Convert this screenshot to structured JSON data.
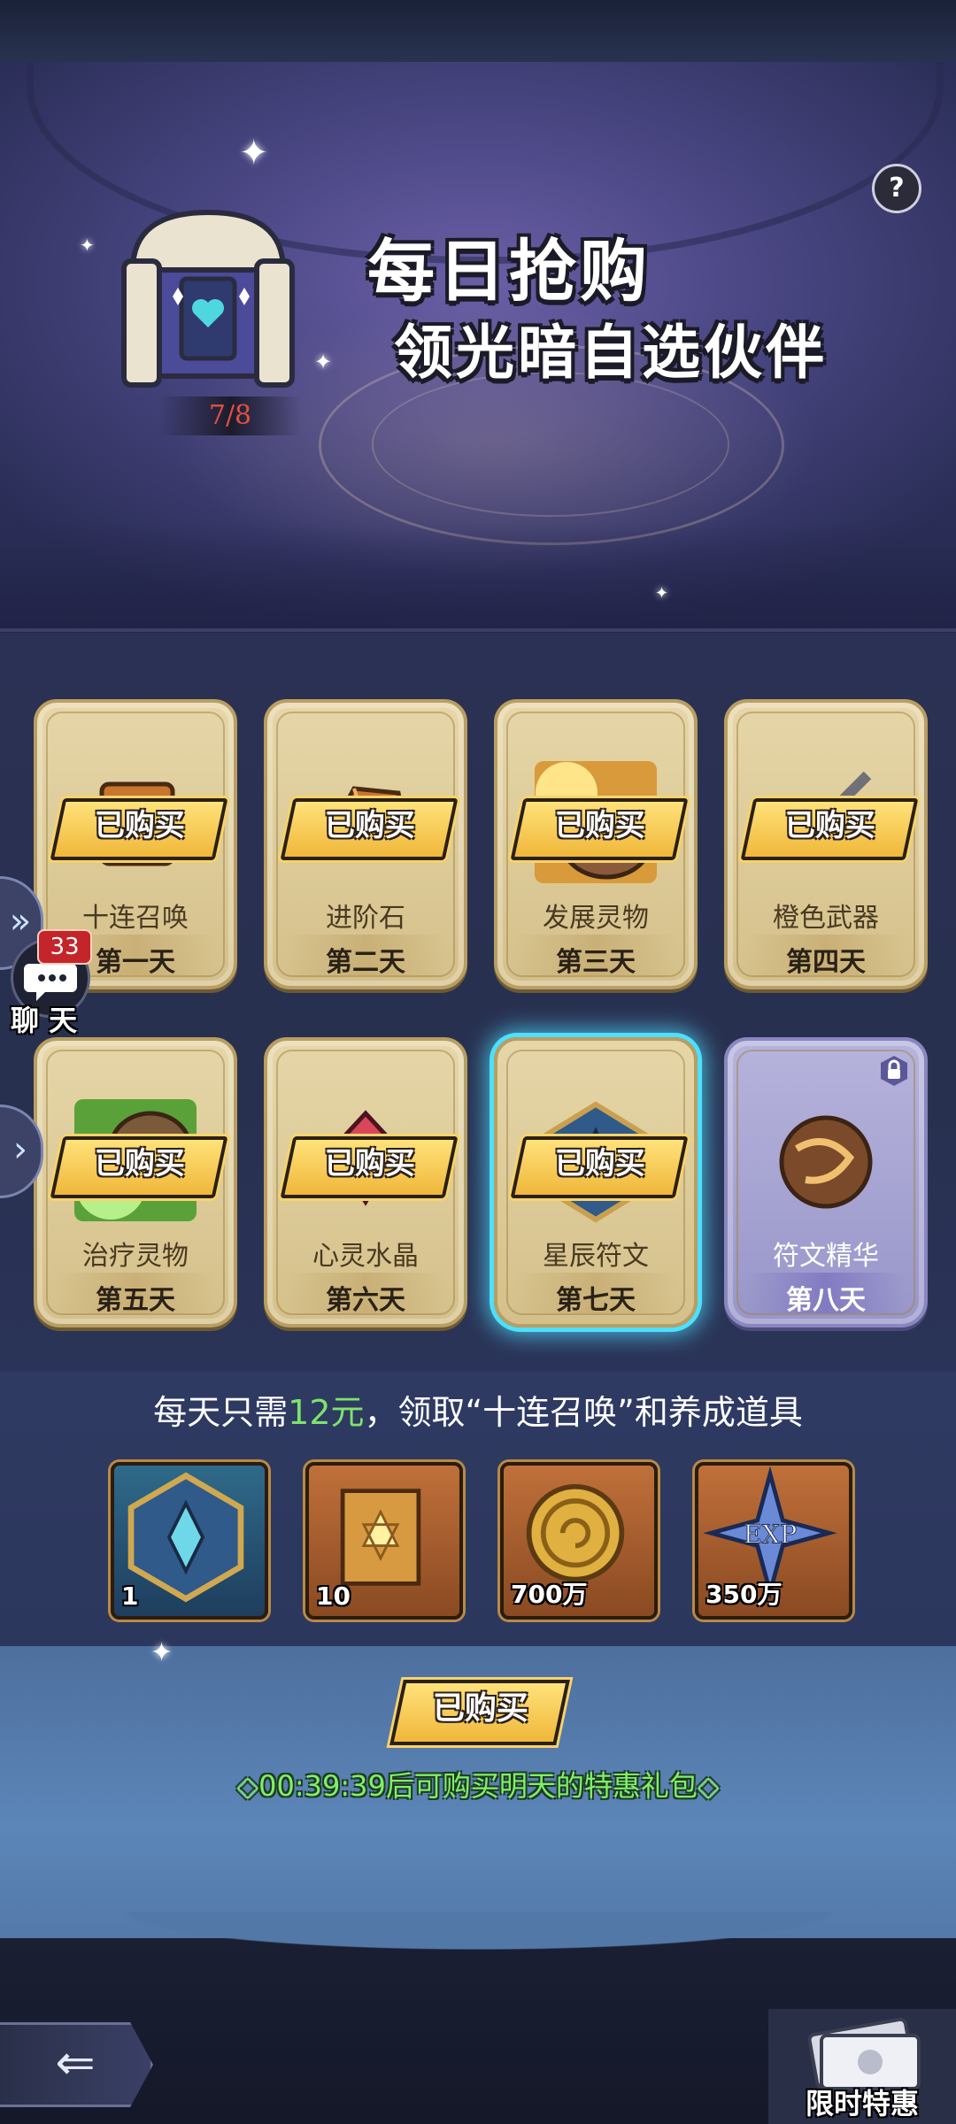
{
  "header": {
    "title_line1": "每日抢购",
    "title_line2": "领光暗自选伙伴",
    "chest_progress": "7/8",
    "help_label": "?"
  },
  "cards": [
    {
      "label": "十连召唤",
      "day": "第一天",
      "purchased": true,
      "icon": "summon-scroll-icon"
    },
    {
      "label": "进阶石",
      "day": "第二天",
      "purchased": true,
      "icon": "advance-stone-icon"
    },
    {
      "label": "发展灵物",
      "day": "第三天",
      "purchased": true,
      "icon": "growth-creature-icon"
    },
    {
      "label": "橙色武器",
      "day": "第四天",
      "purchased": true,
      "icon": "orange-weapon-icon"
    },
    {
      "label": "治疗灵物",
      "day": "第五天",
      "purchased": true,
      "icon": "healing-creature-icon"
    },
    {
      "label": "心灵水晶",
      "day": "第六天",
      "purchased": true,
      "icon": "soul-crystal-icon"
    },
    {
      "label": "星辰符文",
      "day": "第七天",
      "purchased": true,
      "icon": "star-rune-icon"
    },
    {
      "label": "符文精华",
      "day": "第八天",
      "purchased": false,
      "icon": "rune-essence-icon"
    }
  ],
  "purchased_label": "已购买",
  "chat": {
    "count": "33",
    "label": "聊 天"
  },
  "reward_desc": {
    "prefix": "每天只需",
    "price": "12元",
    "suffix": "，领取“十连召唤”和养成道具"
  },
  "rewards": [
    {
      "qty": "1",
      "icon": "star-rune-icon"
    },
    {
      "qty": "10",
      "icon": "summon-scroll-icon"
    },
    {
      "qty": "700万",
      "icon": "gold-coin-icon"
    },
    {
      "qty": "350万",
      "icon": "exp-crystal-icon"
    }
  ],
  "bottom": {
    "purchased_label": "已购买",
    "timer_text": "◇00:39:39后可购买明天的特惠礼包◇",
    "limited_offer_label": "限时特惠"
  },
  "colors": {
    "accent_green": "#7ee36b",
    "badge_gold": "#f0b73a",
    "highlight_cyan": "#4de0ff"
  }
}
